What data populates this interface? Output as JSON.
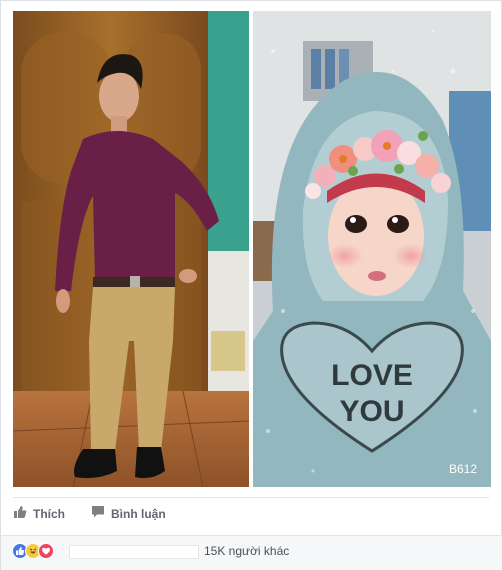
{
  "post": {
    "photos": [
      {
        "name": "photo-man"
      },
      {
        "name": "photo-baby",
        "overlay_text": {
          "line1": "LOVE",
          "line2": "YOU"
        },
        "corner_mark": "B612"
      }
    ]
  },
  "actions": {
    "like_label": "Thích",
    "comment_label": "Bình luận"
  },
  "reactions": {
    "icons": [
      "like-icon",
      "haha-icon",
      "love-icon"
    ],
    "count_text": "15K người khác",
    "colors": {
      "like": "#4a76e8",
      "haha": "#f7c843",
      "love": "#f0435c"
    }
  }
}
